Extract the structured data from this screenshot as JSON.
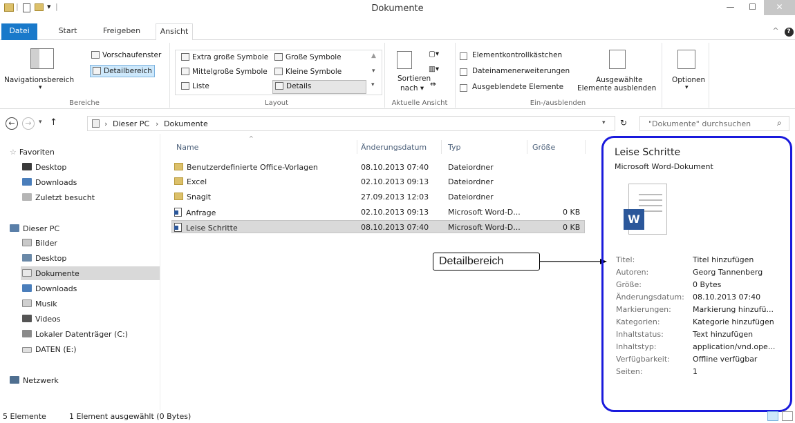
{
  "window": {
    "title": "Dokumente"
  },
  "tabs": {
    "datei": "Datei",
    "start": "Start",
    "freigeben": "Freigeben",
    "ansicht": "Ansicht"
  },
  "ribbon": {
    "navigationsbereich": "Navigationsbereich",
    "vorschaufenster": "Vorschaufenster",
    "detailbereich": "Detailbereich",
    "bereiche": "Bereiche",
    "layout_items": {
      "extra": "Extra große Symbole",
      "gross": "Große Symbole",
      "mittel": "Mittelgroße Symbole",
      "klein": "Kleine Symbole",
      "liste": "Liste",
      "details": "Details"
    },
    "layout": "Layout",
    "sortieren": "Sortieren",
    "nach": "nach",
    "aktuelle_ansicht": "Aktuelle Ansicht",
    "elementkontrollkaestchen": "Elementkontrollkästchen",
    "dateinamenerweiterungen": "Dateinamenerweiterungen",
    "ausgeblendete_elemente": "Ausgeblendete Elemente",
    "ausgewaehlte": "Ausgewählte",
    "elemente_ausblenden": "Elemente ausblenden",
    "ein_ausblenden": "Ein-/ausblenden",
    "optionen": "Optionen"
  },
  "address": {
    "crumbs": [
      "Dieser PC",
      "Dokumente"
    ],
    "search_placeholder": "\"Dokumente\" durchsuchen"
  },
  "nav": {
    "favoriten": "Favoriten",
    "fav_items": [
      "Desktop",
      "Downloads",
      "Zuletzt besucht"
    ],
    "dieser_pc": "Dieser PC",
    "pc_items": [
      "Bilder",
      "Desktop",
      "Dokumente",
      "Downloads",
      "Musik",
      "Videos",
      "Lokaler Datenträger (C:)",
      "DATEN (E:)"
    ],
    "netzwerk": "Netzwerk"
  },
  "columns": {
    "name": "Name",
    "date": "Änderungsdatum",
    "type": "Typ",
    "size": "Größe"
  },
  "files": [
    {
      "name": "Benutzerdefinierte Office-Vorlagen",
      "date": "08.10.2013 07:40",
      "type": "Dateiordner",
      "size": ""
    },
    {
      "name": "Excel",
      "date": "02.10.2013 09:13",
      "type": "Dateiordner",
      "size": ""
    },
    {
      "name": "Snagit",
      "date": "27.09.2013 12:03",
      "type": "Dateiordner",
      "size": ""
    },
    {
      "name": "Anfrage",
      "date": "02.10.2013 09:13",
      "type": "Microsoft Word-D...",
      "size": "0 KB"
    },
    {
      "name": "Leise Schritte",
      "date": "08.10.2013 07:40",
      "type": "Microsoft Word-D...",
      "size": "0 KB"
    }
  ],
  "details": {
    "title": "Leise Schritte",
    "subtitle": "Microsoft Word-Dokument",
    "callout": "Detailbereich",
    "props": [
      {
        "k": "Titel:",
        "v": "Titel hinzufügen"
      },
      {
        "k": "Autoren:",
        "v": "Georg Tannenberg"
      },
      {
        "k": "Größe:",
        "v": "0 Bytes"
      },
      {
        "k": "Änderungsdatum:",
        "v": "08.10.2013 07:40"
      },
      {
        "k": "Markierungen:",
        "v": "Markierung hinzufü..."
      },
      {
        "k": "Kategorien:",
        "v": "Kategorie hinzufügen"
      },
      {
        "k": "Inhaltstatus:",
        "v": "Text hinzufügen"
      },
      {
        "k": "Inhaltstyp:",
        "v": "application/vnd.ope..."
      },
      {
        "k": "Verfügbarkeit:",
        "v": "Offline verfügbar"
      },
      {
        "k": "Seiten:",
        "v": "1"
      }
    ]
  },
  "status": {
    "count": "5 Elemente",
    "selected": "1 Element ausgewählt (0 Bytes)"
  },
  "colors": {
    "accent": "#1979ca",
    "selection": "#d9d9d9",
    "callout_border": "#1a1adc"
  }
}
